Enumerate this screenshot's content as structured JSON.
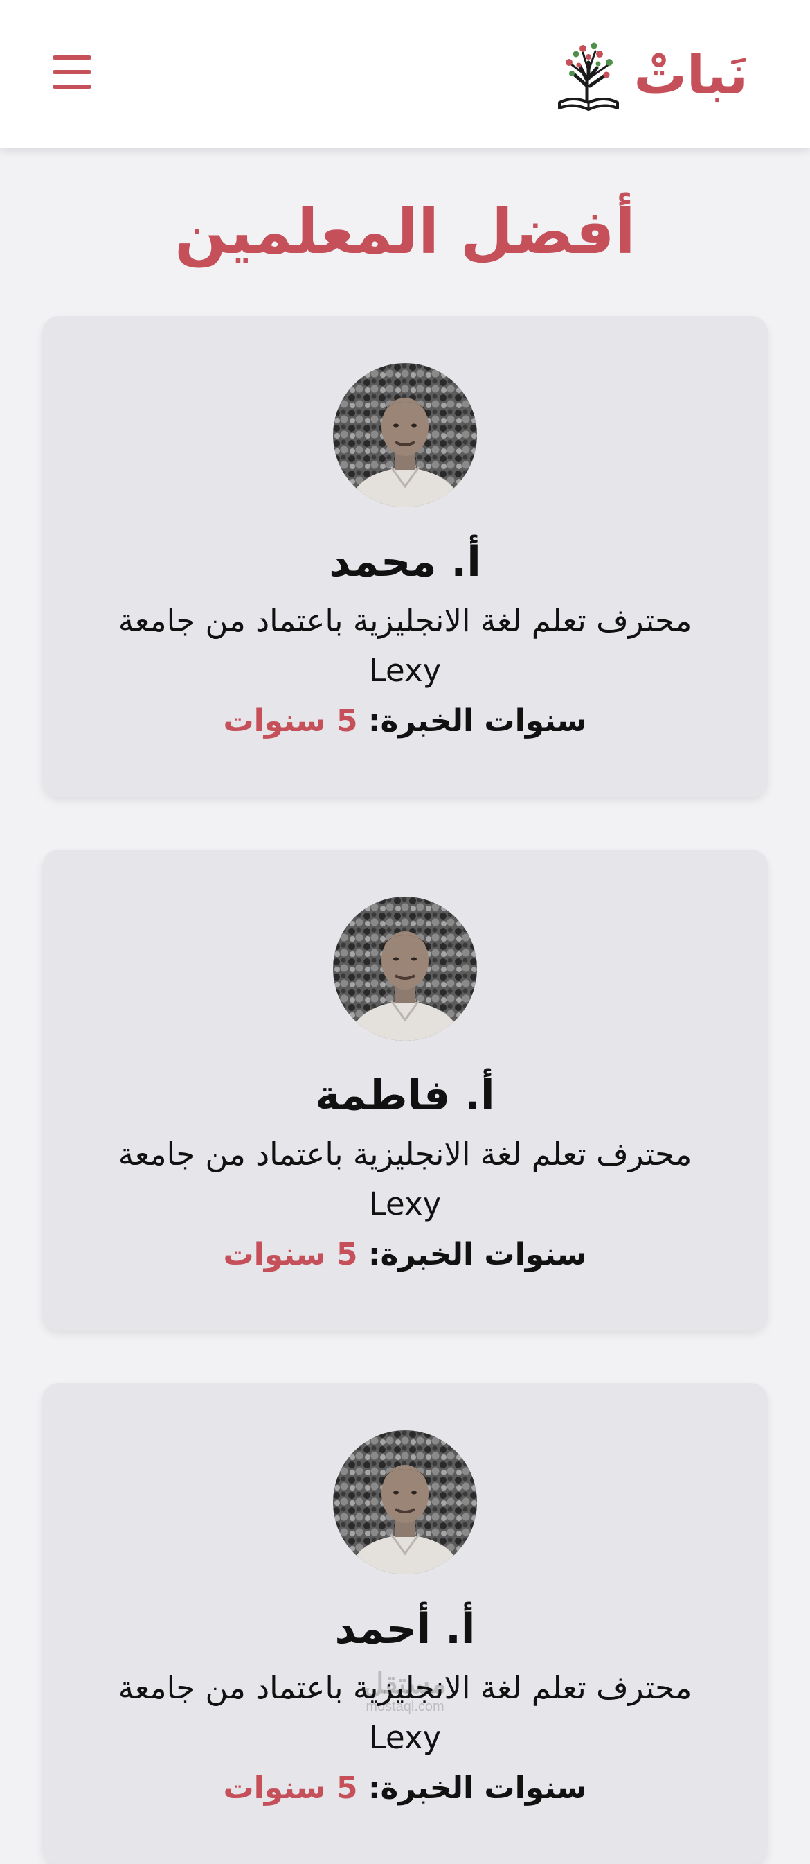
{
  "header": {
    "brand_name": "نَباتْ",
    "logo_icon": "tree-book-icon",
    "menu_icon": "hamburger-menu-icon"
  },
  "page": {
    "title": "أفضل المعلمين"
  },
  "colors": {
    "accent": "#c5505a",
    "card_background": "#e6e6ea",
    "page_background": "#f2f2f4",
    "text": "#111111"
  },
  "teachers": [
    {
      "name": "أ. محمد",
      "description": "محترف تعلم لغة الانجليزية باعتماد من جامعة Lexy",
      "experience_label": "سنوات الخبرة:",
      "experience_value": "5 سنوات"
    },
    {
      "name": "أ. فاطمة",
      "description": "محترف تعلم لغة الانجليزية باعتماد من جامعة Lexy",
      "experience_label": "سنوات الخبرة:",
      "experience_value": "5 سنوات"
    },
    {
      "name": "أ. أحمد",
      "description": "محترف تعلم لغة الانجليزية باعتماد من جامعة Lexy",
      "experience_label": "سنوات الخبرة:",
      "experience_value": "5 سنوات"
    }
  ],
  "watermark": {
    "arabic": "مستقل",
    "latin": "mostaql.com"
  }
}
